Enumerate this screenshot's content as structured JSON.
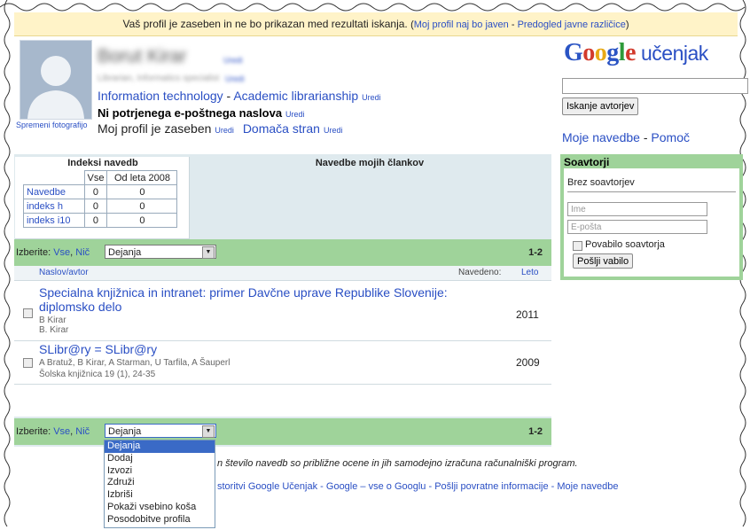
{
  "notice": {
    "text": "Vaš profil je zaseben in ne bo prikazan med rezultati iskanja.",
    "link_public": "Moj profil naj bo javen",
    "link_preview": "Predogled javne različice"
  },
  "profile": {
    "change_photo": "Spremeni fotografijo",
    "name": "Borut Kirar",
    "name_edit": "Uredi",
    "affiliation": "Librarian, Informatics specialist",
    "affiliation_edit": "Uredi",
    "interest1": "Information technology",
    "interest2": "Academic librarianship",
    "interests_edit": "Uredi",
    "email": "Ni potrjenega e-poštnega naslova",
    "email_edit": "Uredi",
    "private": "Moj profil je zaseben",
    "private_edit": "Uredi",
    "homepage": "Domača stran",
    "homepage_edit": "Uredi"
  },
  "logo": {
    "google": "Google",
    "suffix": "učenjak"
  },
  "search": {
    "button": "Iskanje avtorjev",
    "value": ""
  },
  "right_links": {
    "my_citations": "Moje navedbe",
    "help": "Pomoč"
  },
  "citations": {
    "title": "Indeksi navedb",
    "col_all": "Vse",
    "col_since": "Od leta 2008",
    "rows": [
      {
        "label": "Navedbe",
        "all": "0",
        "since": "0"
      },
      {
        "label": "indeks h",
        "all": "0",
        "since": "0"
      },
      {
        "label": "indeks i10",
        "all": "0",
        "since": "0"
      }
    ],
    "articles_title": "Navedbe mojih člankov"
  },
  "selbar": {
    "label": "Izberite:",
    "all": "Vse",
    "none": "Nič",
    "action": "Dejanja",
    "range": "1-2"
  },
  "list": {
    "head_title": "Naslov/avtor",
    "head_cited": "Navedeno:",
    "head_year": "Leto",
    "items": [
      {
        "title_l1": "Specialna knjižnica in intranet: primer Davčne uprave Republike Slovenije:",
        "title_l2": "diplomsko delo",
        "authors": "B Kirar",
        "extra": "B. Kirar",
        "year": "2011"
      },
      {
        "title_l1": "SLibr@ry = SLibr@ry",
        "authors": "A Bratuž, B Kirar, A Starman, U Tarfila, A Šauperl",
        "extra": "Šolska knjižnica 19 (1), 24-35",
        "year": "2009"
      }
    ]
  },
  "coauthors": {
    "title": "Soavtorji",
    "none": "Brez soavtorjev",
    "name_placeholder": "Ime",
    "email_placeholder": "E-pošta",
    "checkbox": "Povabilo soavtorja",
    "send": "Pošlji vabilo"
  },
  "dropdown": {
    "options": [
      "Dejanja",
      "Dodaj",
      "Izvozi",
      "Združi",
      "Izbriši",
      "Pokaži vsebino koša",
      "Posodobitve profila"
    ]
  },
  "footer": {
    "note": "n število navedb so približne ocene in jih samodejno izračuna računalniški program.",
    "about": "storitvi Google Učenjak",
    "google_all": "Google – vse o Googlu",
    "feedback": "Pošlji povratne informacije",
    "my_cites": "Moje navedbe"
  }
}
